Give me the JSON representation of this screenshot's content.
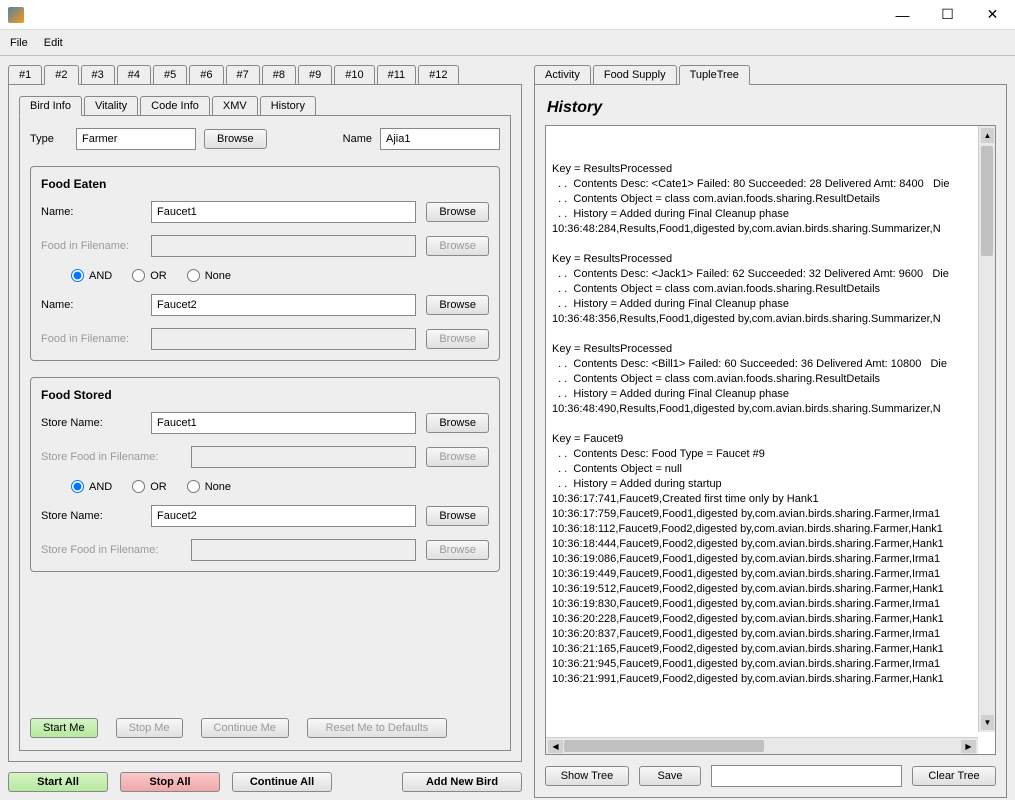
{
  "window": {
    "minimize": "—",
    "maximize": "☐",
    "close": "✕"
  },
  "menu": {
    "file": "File",
    "edit": "Edit"
  },
  "numTabs": [
    "#1",
    "#2",
    "#3",
    "#4",
    "#5",
    "#6",
    "#7",
    "#8",
    "#9",
    "#10",
    "#11",
    "#12"
  ],
  "numTabActive": 1,
  "innerTabs": [
    "Bird Info",
    "Vitality",
    "Code Info",
    "XMV",
    "History"
  ],
  "innerTabActive": 0,
  "typeRow": {
    "label": "Type",
    "value": "Farmer",
    "browse": "Browse",
    "nameLabel": "Name",
    "nameValue": "Ajia1"
  },
  "foodEaten": {
    "title": "Food Eaten",
    "name1Label": "Name:",
    "name1Value": "Faucet1",
    "browse": "Browse",
    "ff1Label": "Food in Filename:",
    "ff1Value": "",
    "radios": {
      "and": "AND",
      "or": "OR",
      "none": "None",
      "selected": "and"
    },
    "name2Label": "Name:",
    "name2Value": "Faucet2",
    "ff2Label": "Food in Filename:",
    "ff2Value": ""
  },
  "foodStored": {
    "title": "Food Stored",
    "sn1Label": "Store Name:",
    "sn1Value": "Faucet1",
    "browse": "Browse",
    "sf1Label": "Store Food in Filename:",
    "sf1Value": "",
    "radios": {
      "and": "AND",
      "or": "OR",
      "none": "None",
      "selected": "and"
    },
    "sn2Label": "Store Name:",
    "sn2Value": "Faucet2",
    "sf2Label": "Store Food in Filename:",
    "sf2Value": ""
  },
  "innerButtons": {
    "start": "Start Me",
    "stop": "Stop Me",
    "cont": "Continue Me",
    "reset": "Reset Me to Defaults"
  },
  "footer": {
    "startAll": "Start All",
    "stopAll": "Stop All",
    "contAll": "Continue All",
    "addNew": "Add New Bird"
  },
  "rightTabs": [
    "Activity",
    "Food Supply",
    "TupleTree"
  ],
  "rightTabActive": 2,
  "historyTitle": "History",
  "historyText": "Key = ResultsProcessed\n  . .  Contents Desc: <Cate1> Failed: 80 Succeeded: 28 Delivered Amt: 8400   Die\n  . .  Contents Object = class com.avian.foods.sharing.ResultDetails\n  . .  History = Added during Final Cleanup phase\n10:36:48:284,Results,Food1,digested by,com.avian.birds.sharing.Summarizer,N\n\nKey = ResultsProcessed\n  . .  Contents Desc: <Jack1> Failed: 62 Succeeded: 32 Delivered Amt: 9600   Die\n  . .  Contents Object = class com.avian.foods.sharing.ResultDetails\n  . .  History = Added during Final Cleanup phase\n10:36:48:356,Results,Food1,digested by,com.avian.birds.sharing.Summarizer,N\n\nKey = ResultsProcessed\n  . .  Contents Desc: <Bill1> Failed: 60 Succeeded: 36 Delivered Amt: 10800   Die\n  . .  Contents Object = class com.avian.foods.sharing.ResultDetails\n  . .  History = Added during Final Cleanup phase\n10:36:48:490,Results,Food1,digested by,com.avian.birds.sharing.Summarizer,N\n\nKey = Faucet9\n  . .  Contents Desc: Food Type = Faucet #9\n  . .  Contents Object = null\n  . .  History = Added during startup\n10:36:17:741,Faucet9,Created first time only by Hank1\n10:36:17:759,Faucet9,Food1,digested by,com.avian.birds.sharing.Farmer,Irma1\n10:36:18:112,Faucet9,Food2,digested by,com.avian.birds.sharing.Farmer,Hank1\n10:36:18:444,Faucet9,Food2,digested by,com.avian.birds.sharing.Farmer,Hank1\n10:36:19:086,Faucet9,Food1,digested by,com.avian.birds.sharing.Farmer,Irma1\n10:36:19:449,Faucet9,Food1,digested by,com.avian.birds.sharing.Farmer,Irma1\n10:36:19:512,Faucet9,Food2,digested by,com.avian.birds.sharing.Farmer,Hank1\n10:36:19:830,Faucet9,Food1,digested by,com.avian.birds.sharing.Farmer,Irma1\n10:36:20:228,Faucet9,Food2,digested by,com.avian.birds.sharing.Farmer,Hank1\n10:36:20:837,Faucet9,Food1,digested by,com.avian.birds.sharing.Farmer,Irma1\n10:36:21:165,Faucet9,Food2,digested by,com.avian.birds.sharing.Farmer,Hank1\n10:36:21:945,Faucet9,Food1,digested by,com.avian.birds.sharing.Farmer,Irma1\n10:36:21:991,Faucet9,Food2,digested by,com.avian.birds.sharing.Farmer,Hank1",
  "rightButtons": {
    "showTree": "Show Tree",
    "save": "Save",
    "clearTree": "Clear Tree"
  }
}
